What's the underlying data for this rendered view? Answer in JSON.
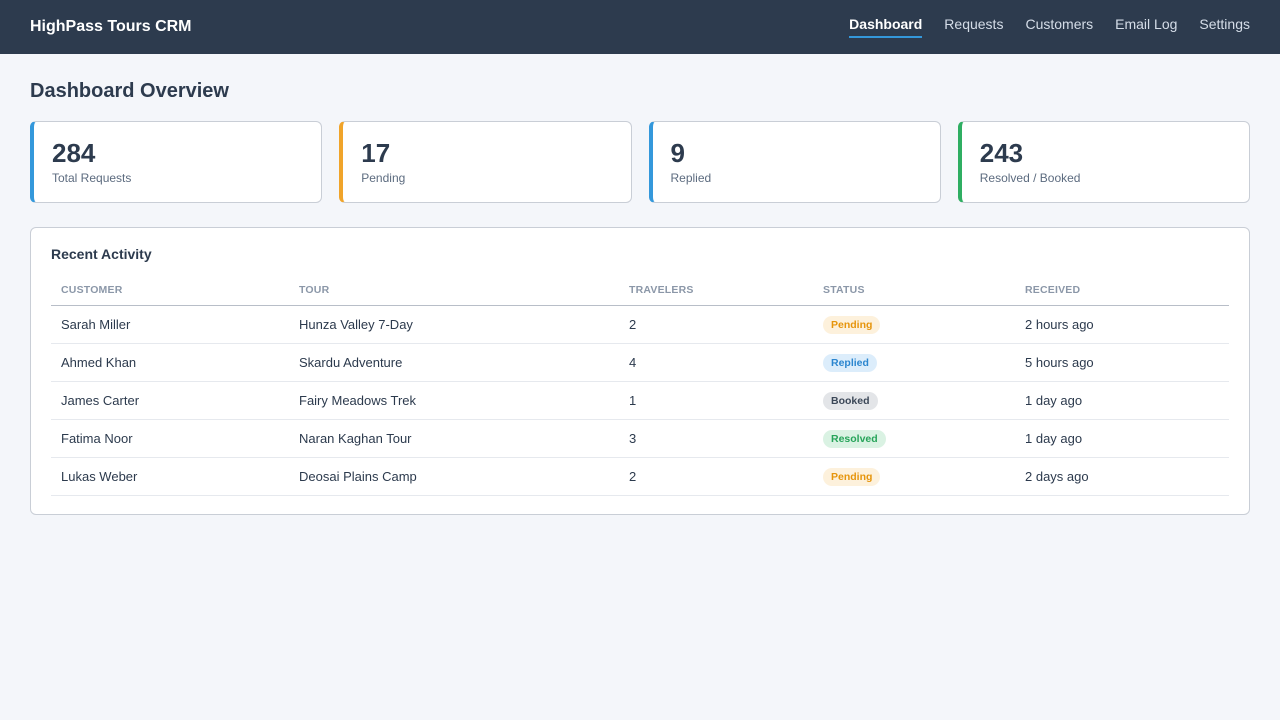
{
  "app": {
    "title": "HighPass Tours CRM"
  },
  "nav": [
    {
      "label": "Dashboard",
      "active": true
    },
    {
      "label": "Requests",
      "active": false
    },
    {
      "label": "Customers",
      "active": false
    },
    {
      "label": "Email Log",
      "active": false
    },
    {
      "label": "Settings",
      "active": false
    }
  ],
  "page": {
    "title": "Dashboard Overview"
  },
  "stats": [
    {
      "value": "284",
      "label": "Total Requests",
      "accent": "#3498db"
    },
    {
      "value": "17",
      "label": "Pending",
      "accent": "#f0a42a"
    },
    {
      "value": "9",
      "label": "Replied",
      "accent": "#3498db"
    },
    {
      "value": "243",
      "label": "Resolved / Booked",
      "accent": "#2fae62"
    }
  ],
  "activity": {
    "title": "Recent Activity",
    "columns": [
      "Customer",
      "Tour",
      "Travelers",
      "Status",
      "Received"
    ],
    "rows": [
      {
        "customer": "Sarah Miller",
        "tour": "Hunza Valley 7-Day",
        "travelers": "2",
        "status": "Pending",
        "received": "2 hours ago"
      },
      {
        "customer": "Ahmed Khan",
        "tour": "Skardu Adventure",
        "travelers": "4",
        "status": "Replied",
        "received": "5 hours ago"
      },
      {
        "customer": "James Carter",
        "tour": "Fairy Meadows Trek",
        "travelers": "1",
        "status": "Booked",
        "received": "1 day ago"
      },
      {
        "customer": "Fatima Noor",
        "tour": "Naran Kaghan Tour",
        "travelers": "3",
        "status": "Resolved",
        "received": "1 day ago"
      },
      {
        "customer": "Lukas Weber",
        "tour": "Deosai Plains Camp",
        "travelers": "2",
        "status": "Pending",
        "received": "2 days ago"
      }
    ]
  }
}
